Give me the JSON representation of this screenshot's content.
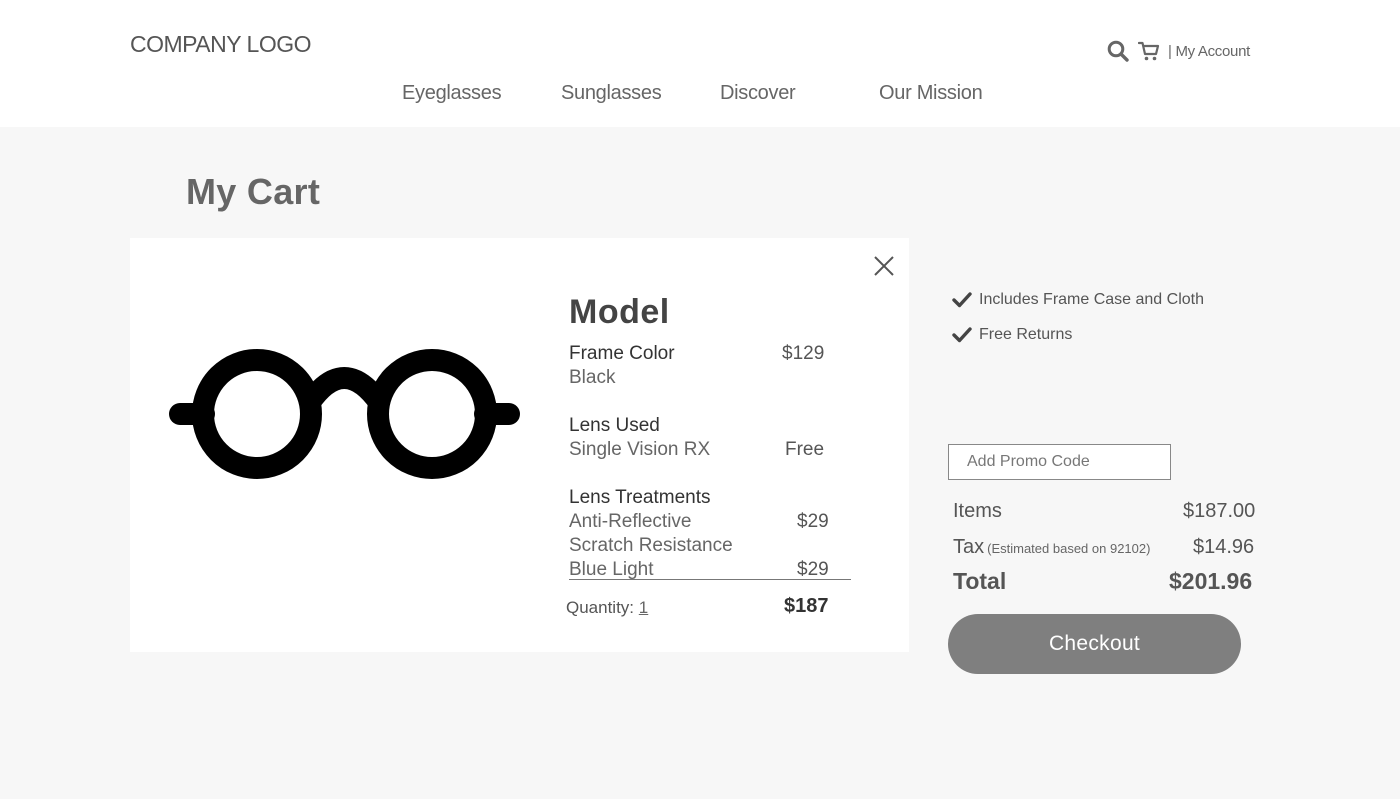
{
  "header": {
    "logo": "COMPANY LOGO",
    "account_label": "| My Account",
    "icons": [
      "search-icon",
      "cart-icon"
    ],
    "nav": [
      "Eyeglasses",
      "Sunglasses",
      "Discover",
      "Our Mission"
    ]
  },
  "page_title": "My Cart",
  "cart_item": {
    "model": "Model",
    "frame_color_label": "Frame Color",
    "frame_color_value": "Black",
    "frame_price": "$129",
    "lens_used_label": "Lens Used",
    "lens_used_value": "Single Vision RX",
    "lens_used_price": "Free",
    "treatments_label": "Lens Treatments",
    "treatments": [
      {
        "name": "Anti-Reflective",
        "price": "$29"
      },
      {
        "name": "Scratch Resistance",
        "price": ""
      },
      {
        "name": "Blue Light",
        "price": "$29"
      }
    ],
    "quantity_label": "Quantity:",
    "quantity_value": "1",
    "subtotal": "$187",
    "remove_icon": "close-icon",
    "image_icon": "eyeglasses-icon"
  },
  "perks": [
    "Includes Frame Case and Cloth",
    "Free Returns"
  ],
  "promo": {
    "placeholder": "Add Promo Code"
  },
  "summary": {
    "items_label": "Items",
    "items_value": "$187.00",
    "tax_label": "Tax",
    "tax_note": "(Estimated based on 92102)",
    "tax_value": "$14.96",
    "total_label": "Total",
    "total_value": "$201.96"
  },
  "checkout_label": "Checkout",
  "colors": {
    "page_bg": "#f7f7f7",
    "card_bg": "#ffffff",
    "button_bg": "#7f7f7f",
    "text": "#555555"
  }
}
